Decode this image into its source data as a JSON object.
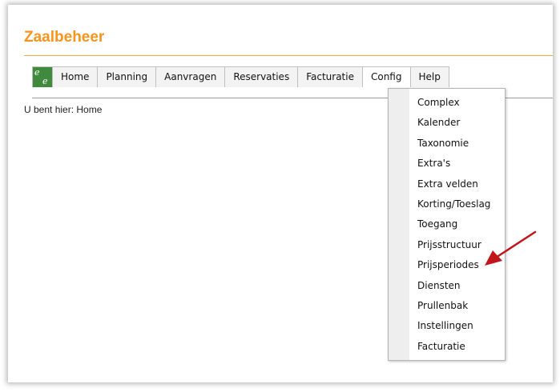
{
  "app": {
    "title": "Zaalbeheer"
  },
  "nav": {
    "logo_text_top": "e",
    "logo_text_bottom": "e",
    "items": [
      {
        "label": "Home"
      },
      {
        "label": "Planning"
      },
      {
        "label": "Aanvragen"
      },
      {
        "label": "Reservaties"
      },
      {
        "label": "Facturatie"
      },
      {
        "label": "Config",
        "active": true
      },
      {
        "label": "Help"
      }
    ]
  },
  "breadcrumb": {
    "text": "U bent hier: Home"
  },
  "config_menu": {
    "items": [
      {
        "label": "Complex"
      },
      {
        "label": "Kalender"
      },
      {
        "label": "Taxonomie"
      },
      {
        "label": "Extra's"
      },
      {
        "label": "Extra velden"
      },
      {
        "label": "Korting/Toeslag"
      },
      {
        "label": "Toegang"
      },
      {
        "label": "Prijsstructuur"
      },
      {
        "label": "Prijsperiodes",
        "highlighted_by_arrow": true
      },
      {
        "label": "Diensten"
      },
      {
        "label": "Prullenbak"
      },
      {
        "label": "Instellingen"
      },
      {
        "label": "Facturatie"
      }
    ]
  },
  "colors": {
    "brand_orange": "#f7941d",
    "logo_green": "#3f8a3d",
    "annotation_arrow": "#c0161b"
  }
}
